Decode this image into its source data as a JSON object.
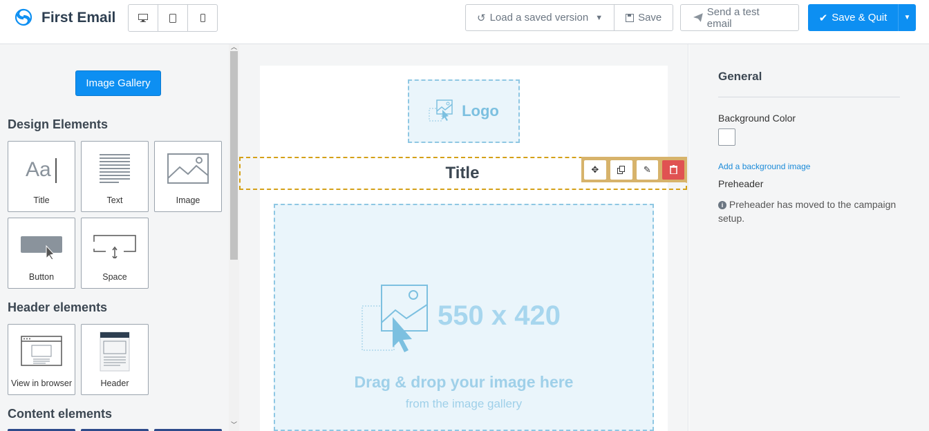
{
  "app": {
    "title": "First Email"
  },
  "header": {
    "load_version": "Load a saved version",
    "save": "Save",
    "send_test": "Send a test email",
    "save_quit": "Save & Quit"
  },
  "left_panel": {
    "gallery_button": "Image Gallery",
    "sections": {
      "design": "Design Elements",
      "header": "Header elements",
      "content": "Content elements"
    },
    "design_items": [
      "Title",
      "Text",
      "Image",
      "Button",
      "Space"
    ],
    "header_items": [
      "View in browser",
      "Header"
    ]
  },
  "canvas": {
    "logo_placeholder": "Logo",
    "title_block": "Title",
    "image_size": "550 x 420",
    "image_drag": "Drag & drop your image here",
    "image_from": "from the image gallery"
  },
  "right_panel": {
    "heading": "General",
    "bg_color_label": "Background Color",
    "bg_image_link": "Add a background image",
    "preheader_label": "Preheader",
    "preheader_note": "Preheader has moved to the campaign setup."
  },
  "colors": {
    "primary": "#0d8ff2",
    "danger": "#e05252",
    "selection": "#d4a017",
    "placeholder": "#eaf5fb"
  }
}
